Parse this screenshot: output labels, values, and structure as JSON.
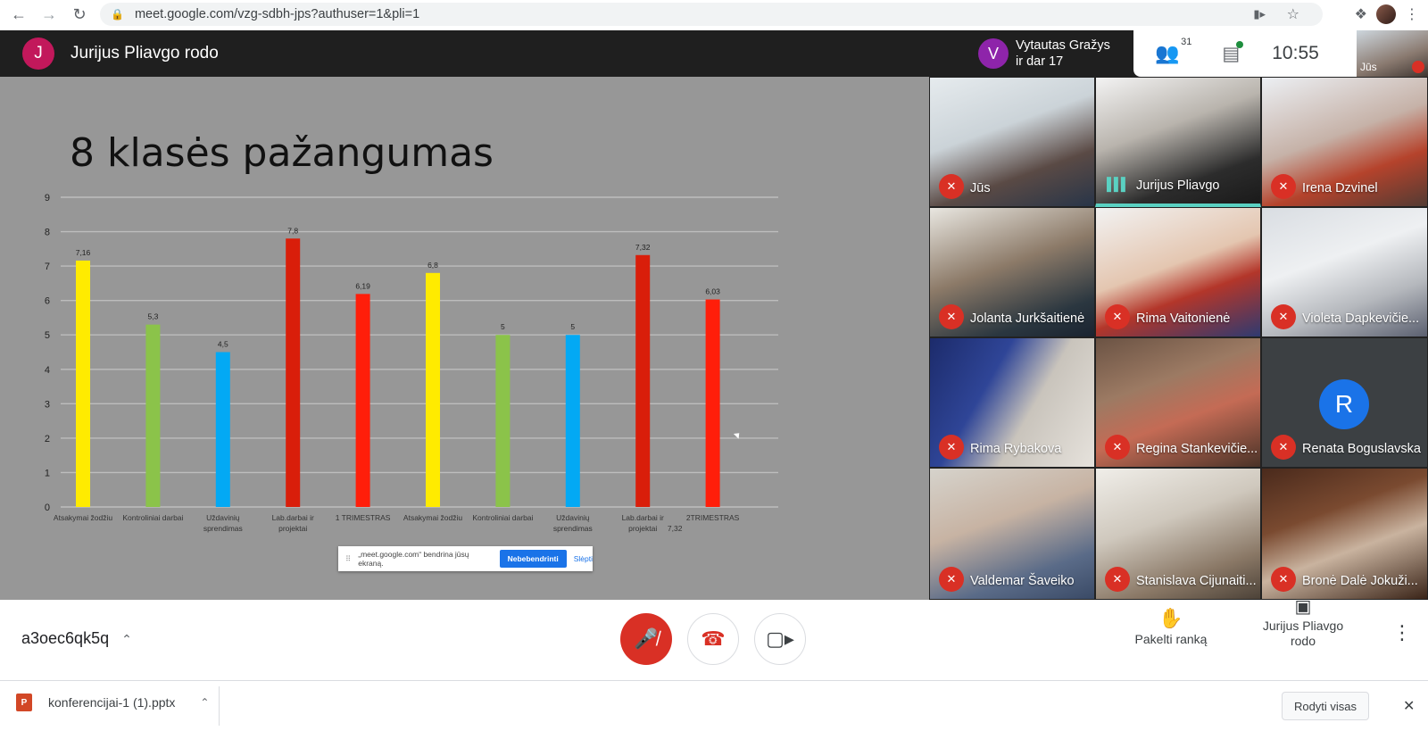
{
  "browser": {
    "url": "meet.google.com/vzg-sdbh-jps?authuser=1&pli=1"
  },
  "meet": {
    "presenter_initial": "J",
    "presenter_title": "Jurijus Pliavgo rodo",
    "notification": {
      "initial": "V",
      "line1": "Vytautas Gražys",
      "line2": "ir dar 17"
    },
    "people_count": "31",
    "clock": "10:55",
    "self_label": "Jūs"
  },
  "slide": {
    "title": "8 klasės pažangumas",
    "share_bar": {
      "text": "„meet.google.com“ bendrina jūsų ekraną.",
      "stop_label": "Nebebendrinti",
      "hide_label": "Slėpti"
    }
  },
  "chart_data": {
    "type": "bar",
    "title": "8 klasės pažangumas",
    "categories": [
      "Atsakymai žodžiu",
      "Kontroliniai darbai",
      "Uždavinių sprendimas",
      "Lab.darbai ir projektai",
      "1 TRIMESTRAS",
      "Atsakymai žodžiu",
      "Kontroliniai darbai",
      "Uždavinių sprendimas",
      "Lab.darbai ir projektai",
      "2TRIMESTRAS"
    ],
    "values": [
      7.16,
      5.3,
      4.5,
      7.8,
      6.19,
      6.8,
      5,
      5,
      7.32,
      6.03
    ],
    "value_labels": [
      "7,16",
      "5,3",
      "4,5",
      "7,8",
      "6,19",
      "6,8",
      "5",
      "5",
      "7,32",
      "6,03"
    ],
    "colors": [
      "#ffeb00",
      "#8bc34a",
      "#03a9f4",
      "#d91e0a",
      "#ff1e0a",
      "#ffeb00",
      "#8bc34a",
      "#03a9f4",
      "#d91e0a",
      "#ff1e0a"
    ],
    "ylim": [
      0,
      9
    ],
    "yticks": [
      "0",
      "1",
      "2",
      "3",
      "4",
      "5",
      "6",
      "7",
      "8",
      "9"
    ],
    "extra_label": "7,32",
    "grid": true
  },
  "participants": [
    {
      "name": "Jūs",
      "state": "muted"
    },
    {
      "name": "Jurijus Pliavgo",
      "state": "speaking"
    },
    {
      "name": "Irena Dzvinel",
      "state": "muted"
    },
    {
      "name": "Jolanta Jurkšaitienė",
      "state": "muted"
    },
    {
      "name": "Rima Vaitonienė",
      "state": "muted"
    },
    {
      "name": "Violeta Dapkevičie...",
      "state": "muted"
    },
    {
      "name": "Rima Rybakova",
      "state": "muted"
    },
    {
      "name": "Regina Stankevičie...",
      "state": "muted"
    },
    {
      "name": "Renata Boguslavska",
      "state": "muted",
      "initial": "R"
    },
    {
      "name": "Valdemar Šaveiko",
      "state": "muted"
    },
    {
      "name": "Stanislava Cijunaiti...",
      "state": "muted"
    },
    {
      "name": "Bronė Dalė Jokuži...",
      "state": "muted"
    }
  ],
  "controls": {
    "meeting_code": "a3oec6qk5q",
    "raise_hand": "Pakelti ranką",
    "presenting_line1": "Jurijus Pliavgo",
    "presenting_line2": "rodo"
  },
  "download": {
    "file_name": "konferencijai-1 (1).pptx",
    "show_all": "Rodyti visas"
  }
}
